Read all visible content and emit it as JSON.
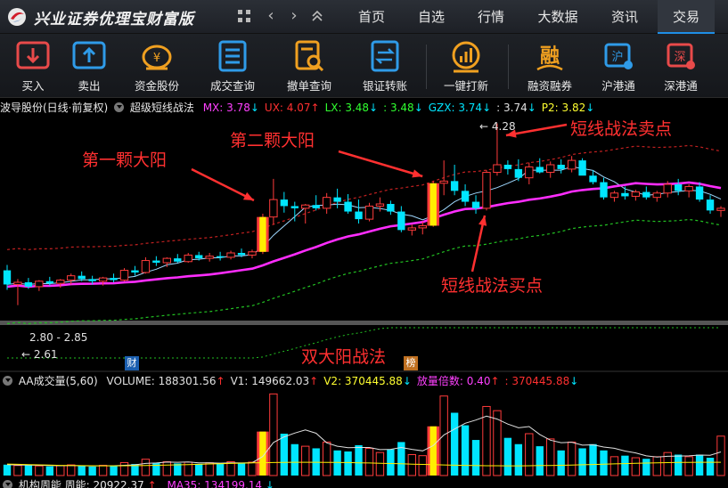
{
  "app": {
    "title": "兴业证券优理宝财富版"
  },
  "menu": [
    "首页",
    "自选",
    "行情",
    "大数据",
    "资讯",
    "交易"
  ],
  "menu_active_index": 5,
  "toolbar": [
    {
      "label": "买入",
      "icon": "buy-icon",
      "color": "#e84a4a"
    },
    {
      "label": "卖出",
      "icon": "sell-icon",
      "color": "#2f9be8"
    },
    {
      "label": "资金股份",
      "icon": "money-bag-icon",
      "color": "#f0a020"
    },
    {
      "label": "成交查询",
      "icon": "list-icon",
      "color": "#2f9be8"
    },
    {
      "label": "撤单查询",
      "icon": "search-doc-icon",
      "color": "#f0a020"
    },
    {
      "label": "银证转账",
      "icon": "transfer-icon",
      "color": "#2f9be8"
    },
    {
      "label": "一键打新",
      "icon": "chart-coin-icon",
      "color": "#f0a020"
    },
    {
      "label": "融资融券",
      "icon": "margin-icon",
      "color": "#f0a020"
    },
    {
      "label": "沪港通",
      "icon": "shanghai-hk-icon",
      "color": "#2f9be8"
    },
    {
      "label": "深港通",
      "icon": "shenzhen-hk-icon",
      "color": "#e84a4a"
    }
  ],
  "indicator": {
    "stock": "波导股份(日线·前复权)",
    "name": "超级短线战法",
    "values": [
      {
        "label": "MX: 3.78",
        "arrow": "↓",
        "color": "#ff40ff",
        "arrow_color": "#00e5ff"
      },
      {
        "label": "UX: 4.07",
        "arrow": "↑",
        "color": "#ff3030",
        "arrow_color": "#ff3030"
      },
      {
        "label": "LX: 3.48",
        "arrow": "↓",
        "color": "#30ff30",
        "arrow_color": "#00e5ff"
      },
      {
        "label": ": 3.48",
        "arrow": "↓",
        "color": "#30ff30",
        "arrow_color": "#00e5ff"
      },
      {
        "label": "GZX: 3.74",
        "arrow": "↓",
        "color": "#00e5ff",
        "arrow_color": "#00e5ff"
      },
      {
        "label": ": 3.74",
        "arrow": "↓",
        "color": "#e0e0e0",
        "arrow_color": "#00e5ff"
      },
      {
        "label": "P2: 3.82",
        "arrow": "↓",
        "color": "#ffff30",
        "arrow_color": "#00e5ff"
      }
    ]
  },
  "annotations": {
    "first_yang": "第一颗大阳",
    "second_yang": "第二颗大阳",
    "sell_point": "短线战法卖点",
    "buy_point": "短线战法买点",
    "strategy": "双大阳战法"
  },
  "price_notes": {
    "high": "4.28",
    "range": "2.80 - 2.85",
    "low": "2.61"
  },
  "badges": {
    "cai": "财",
    "bang": "榜"
  },
  "volume": {
    "name": "AA成交量(5,60)",
    "values": [
      {
        "label": "VOLUME: 188301.56",
        "arrow": "↑",
        "color": "#e0e0e0",
        "arrow_color": "#ff3030"
      },
      {
        "label": "V1: 149662.03",
        "arrow": "↑",
        "color": "#e0e0e0",
        "arrow_color": "#ff3030"
      },
      {
        "label": "V2: 370445.88",
        "arrow": "↓",
        "color": "#ffff30",
        "arrow_color": "#00e5ff"
      },
      {
        "label": "放量倍数: 0.40",
        "arrow": "↑",
        "color": "#ff40ff",
        "arrow_color": "#ff3030"
      },
      {
        "label": ": 370445.88",
        "arrow": "↓",
        "color": "#ff3030",
        "arrow_color": "#00e5ff"
      }
    ]
  },
  "bottom_indicator": {
    "text": "机构周能  周能: 20922.37",
    "arrow": "↑",
    "ma": "MA35: 134199.14",
    "ma_arrow": "↓"
  },
  "colors": {
    "up": "#ff3b3b",
    "down": "#00e5ff",
    "highlight": "#ffee00",
    "ma_main": "#ff2dff",
    "upper_band": "#c02020",
    "lower_band": "#22c022"
  },
  "chart_data": {
    "type": "candlestick",
    "candles": [
      [
        2.93,
        2.98,
        2.75,
        2.8
      ],
      [
        2.8,
        2.85,
        2.61,
        2.82
      ],
      [
        2.82,
        2.86,
        2.76,
        2.78
      ],
      [
        2.78,
        2.84,
        2.74,
        2.83
      ],
      [
        2.83,
        2.87,
        2.79,
        2.81
      ],
      [
        2.81,
        2.85,
        2.77,
        2.84
      ],
      [
        2.84,
        2.9,
        2.8,
        2.88
      ],
      [
        2.88,
        2.92,
        2.83,
        2.85
      ],
      [
        2.85,
        2.88,
        2.8,
        2.83
      ],
      [
        2.83,
        2.87,
        2.79,
        2.86
      ],
      [
        2.86,
        2.9,
        2.82,
        2.84
      ],
      [
        2.84,
        2.95,
        2.83,
        2.93
      ],
      [
        2.93,
        2.97,
        2.88,
        2.91
      ],
      [
        2.91,
        3.05,
        2.9,
        3.02
      ],
      [
        3.02,
        3.06,
        2.97,
        3.0
      ],
      [
        3.0,
        3.05,
        2.96,
        3.04
      ],
      [
        3.04,
        3.08,
        3.0,
        3.01
      ],
      [
        3.01,
        3.09,
        3.0,
        3.07
      ],
      [
        3.07,
        3.1,
        3.02,
        3.04
      ],
      [
        3.04,
        3.09,
        3.01,
        3.06
      ],
      [
        3.06,
        3.1,
        3.02,
        3.05
      ],
      [
        3.05,
        3.11,
        3.03,
        3.09
      ],
      [
        3.09,
        3.13,
        3.05,
        3.07
      ],
      [
        3.07,
        3.12,
        3.04,
        3.1
      ],
      [
        3.1,
        3.45,
        3.08,
        3.42
      ],
      [
        3.42,
        3.77,
        3.35,
        3.58
      ],
      [
        3.58,
        3.65,
        3.46,
        3.52
      ],
      [
        3.52,
        3.56,
        3.38,
        3.5
      ],
      [
        3.5,
        3.54,
        3.36,
        3.53
      ],
      [
        3.53,
        3.62,
        3.48,
        3.5
      ],
      [
        3.5,
        3.64,
        3.45,
        3.6
      ],
      [
        3.6,
        3.68,
        3.5,
        3.56
      ],
      [
        3.56,
        3.63,
        3.45,
        3.47
      ],
      [
        3.47,
        3.58,
        3.36,
        3.4
      ],
      [
        3.4,
        3.55,
        3.38,
        3.52
      ],
      [
        3.52,
        3.6,
        3.47,
        3.54
      ],
      [
        3.54,
        3.57,
        3.44,
        3.47
      ],
      [
        3.47,
        3.52,
        3.28,
        3.3
      ],
      [
        3.3,
        3.35,
        3.25,
        3.32
      ],
      [
        3.32,
        3.38,
        3.26,
        3.34
      ],
      [
        3.34,
        3.75,
        3.33,
        3.73
      ],
      [
        3.73,
        3.94,
        3.62,
        3.75
      ],
      [
        3.75,
        3.9,
        3.62,
        3.66
      ],
      [
        3.66,
        3.72,
        3.52,
        3.56
      ],
      [
        3.56,
        3.62,
        3.45,
        3.5
      ],
      [
        3.5,
        3.85,
        3.48,
        3.83
      ],
      [
        3.83,
        4.28,
        3.8,
        3.9
      ],
      [
        3.9,
        3.94,
        3.81,
        3.86
      ],
      [
        3.86,
        3.95,
        3.75,
        3.78
      ],
      [
        3.78,
        3.92,
        3.72,
        3.88
      ],
      [
        3.88,
        3.96,
        3.82,
        3.83
      ],
      [
        3.83,
        3.93,
        3.78,
        3.9
      ],
      [
        3.9,
        3.95,
        3.82,
        3.86
      ],
      [
        3.86,
        3.98,
        3.83,
        3.94
      ],
      [
        3.94,
        3.96,
        3.82,
        3.8
      ],
      [
        3.8,
        3.85,
        3.72,
        3.74
      ],
      [
        3.74,
        3.78,
        3.58,
        3.6
      ],
      [
        3.6,
        3.66,
        3.56,
        3.64
      ],
      [
        3.64,
        3.7,
        3.58,
        3.61
      ],
      [
        3.61,
        3.67,
        3.57,
        3.65
      ],
      [
        3.65,
        3.7,
        3.58,
        3.6
      ],
      [
        3.6,
        3.66,
        3.56,
        3.64
      ],
      [
        3.64,
        3.75,
        3.6,
        3.72
      ],
      [
        3.72,
        3.77,
        3.62,
        3.66
      ],
      [
        3.66,
        3.72,
        3.6,
        3.7
      ],
      [
        3.7,
        3.74,
        3.56,
        3.58
      ],
      [
        3.58,
        3.62,
        3.45,
        3.48
      ],
      [
        3.48,
        3.52,
        3.42,
        3.5
      ]
    ],
    "highlight_candles": [
      24,
      40
    ],
    "volume": [
      52000,
      48000,
      50000,
      46000,
      44000,
      47000,
      51000,
      45000,
      43000,
      49000,
      46000,
      62000,
      55000,
      78000,
      60000,
      66000,
      58000,
      64000,
      56000,
      61000,
      57000,
      66000,
      59000,
      64000,
      210000,
      390000,
      200000,
      150000,
      140000,
      130000,
      160000,
      120000,
      115000,
      145000,
      130000,
      110000,
      125000,
      160000,
      100000,
      95000,
      235000,
      380000,
      300000,
      240000,
      170000,
      330000,
      310000,
      180000,
      150000,
      200000,
      140000,
      175000,
      120000,
      160000,
      130000,
      150000,
      120000,
      90000,
      95000,
      85000,
      80000,
      90000,
      110000,
      100000,
      90000,
      100000,
      85000,
      188301
    ]
  }
}
